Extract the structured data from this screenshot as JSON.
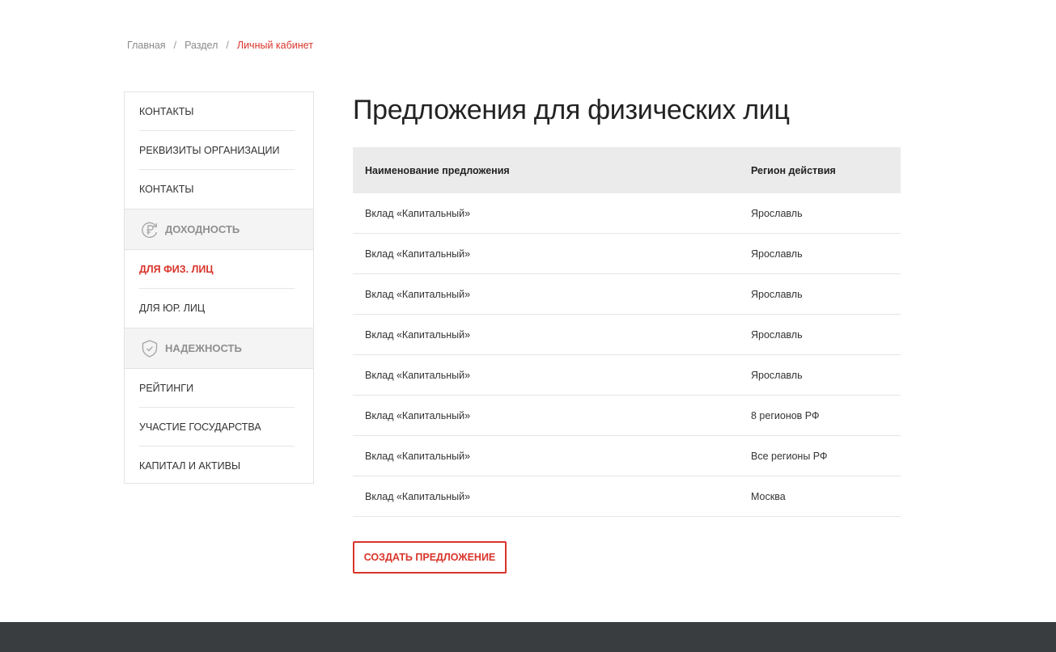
{
  "breadcrumb": {
    "items": [
      "Главная",
      "Раздел"
    ],
    "separator": "/",
    "current": "Личный кабинет"
  },
  "sidebar": {
    "top_items": [
      "КОНТАКТЫ",
      "РЕКВИЗИТЫ ОРГАНИЗАЦИИ",
      "КОНТАКТЫ"
    ],
    "group1": {
      "label": "ДОХОДНОСТЬ",
      "icon": "ruble-refresh-icon",
      "items": [
        "ДЛЯ ФИЗ. ЛИЦ",
        "ДЛЯ ЮР. ЛИЦ"
      ]
    },
    "group2": {
      "label": "НАДЕЖНОСТЬ",
      "icon": "shield-check-icon",
      "items": [
        "РЕЙТИНГИ",
        "УЧАСТИЕ ГОСУДАРСТВА",
        "КАПИТАЛ И АКТИВЫ"
      ]
    }
  },
  "main": {
    "title": "Предложения для физических лиц"
  },
  "table": {
    "headers": [
      "Наименование предложения",
      "Регион действия"
    ],
    "rows": [
      [
        "Вклад «Капитальный»",
        "Ярославль"
      ],
      [
        "Вклад «Капитальный»",
        "Ярославль"
      ],
      [
        "Вклад «Капитальный»",
        "Ярославль"
      ],
      [
        "Вклад «Капитальный»",
        "Ярославль"
      ],
      [
        "Вклад «Капитальный»",
        "Ярославль"
      ],
      [
        "Вклад «Капитальный»",
        "8 регионов РФ"
      ],
      [
        "Вклад «Капитальный»",
        "Все регионы РФ"
      ],
      [
        "Вклад «Капитальный»",
        "Москва"
      ]
    ]
  },
  "create_button": "СОЗДАТЬ ПРЕДЛОЖЕНИЕ",
  "colors": {
    "accent": "#d9342b",
    "footer": "#3a3d40",
    "table_header_bg": "#ebebeb",
    "group_bg": "#f4f4f4"
  }
}
